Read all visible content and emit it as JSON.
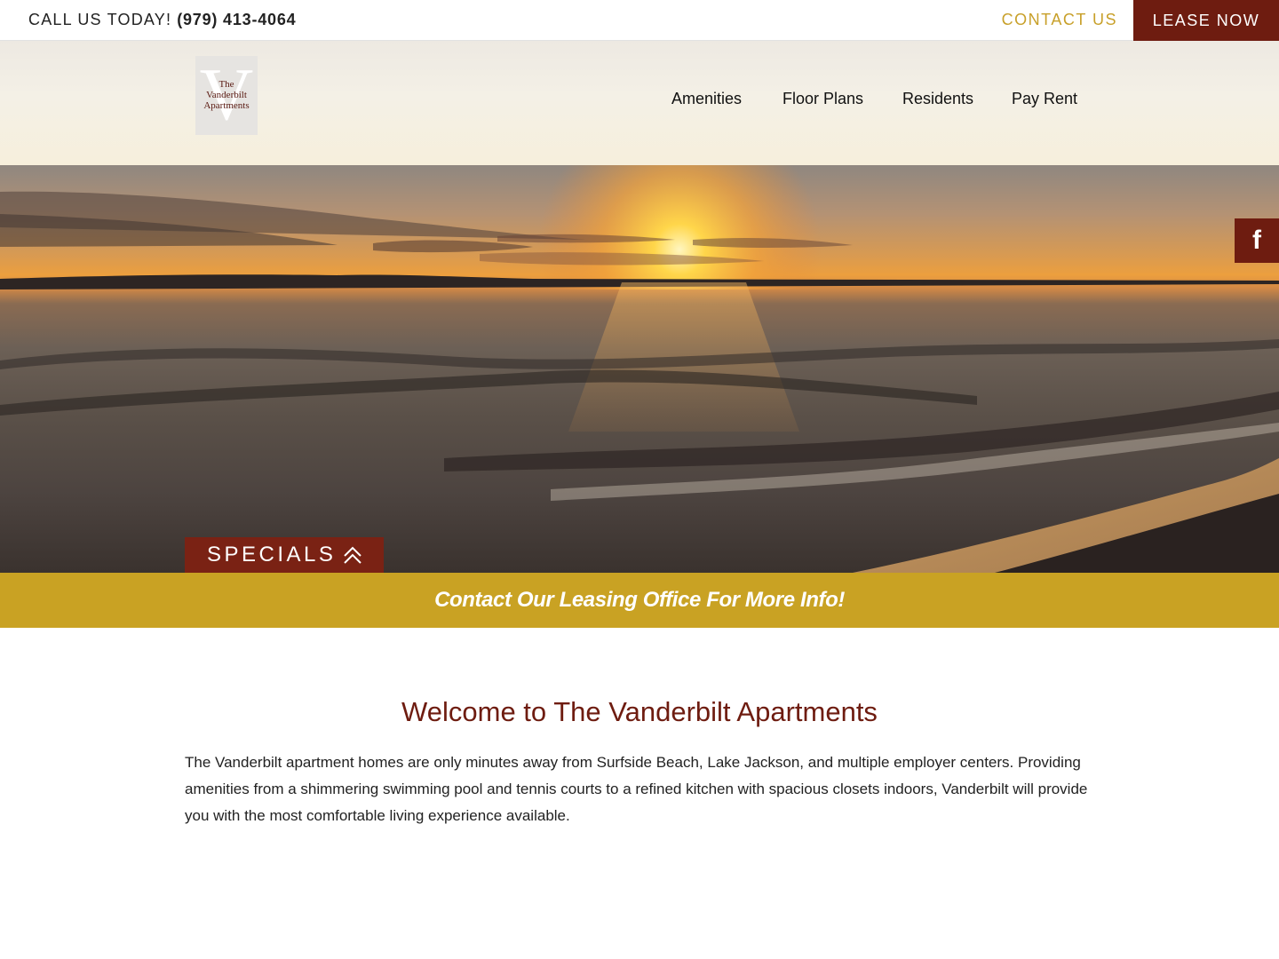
{
  "topbar": {
    "call_label": "CALL US TODAY!",
    "phone": "(979) 413-4064",
    "contact_label": "CONTACT US",
    "lease_label": "LEASE NOW"
  },
  "logo": {
    "letter": "V",
    "line1": "The",
    "line2": "Vanderbilt",
    "line3": "Apartments"
  },
  "nav": {
    "items": [
      {
        "label": "Amenities"
      },
      {
        "label": "Floor Plans"
      },
      {
        "label": "Residents"
      },
      {
        "label": "Pay Rent"
      }
    ]
  },
  "hero": {
    "facebook_icon": "facebook-icon",
    "specials_label": "SPECIALS",
    "specials_icon": "double-chevron-up-icon"
  },
  "promo": {
    "text": "Contact Our Leasing Office For More Info!"
  },
  "welcome": {
    "title": "Welcome to The Vanderbilt Apartments",
    "body": "The Vanderbilt apartment homes are only minutes away from Surfside Beach, Lake Jackson, and multiple employer centers. Providing amenities from a shimmering swimming pool and tennis courts to a refined kitchen with spacious closets indoors, Vanderbilt will provide you with the most comfortable living experience available."
  },
  "colors": {
    "brand_red": "#6e1c10",
    "gold": "#c9a223",
    "contact_gold": "#c8a02a"
  }
}
